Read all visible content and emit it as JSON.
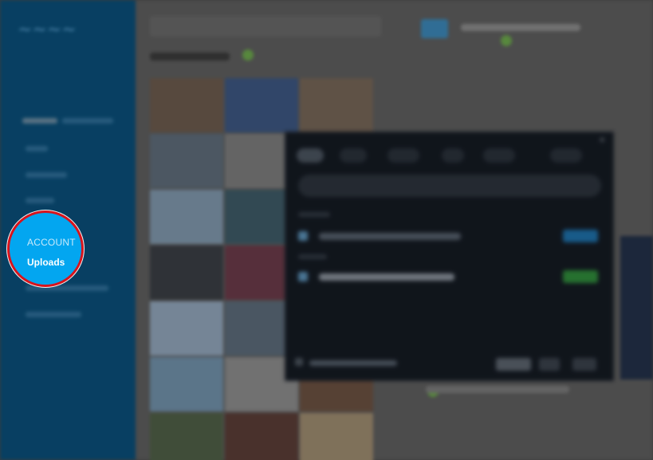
{
  "sidebar": {
    "section_label": "ACCOUNT",
    "highlighted_item": "Uploads"
  },
  "colors": {
    "sidebar_bg": "#0a4e78",
    "spotlight_fill": "#03a6f0",
    "spotlight_ring": "#d8131c",
    "dialog_bg": "#141a22",
    "accent_blue": "#3b86b6",
    "accent_green": "#6ba64b"
  },
  "icons": {
    "dialog_close": "close-icon",
    "check": "checkbox-icon"
  }
}
